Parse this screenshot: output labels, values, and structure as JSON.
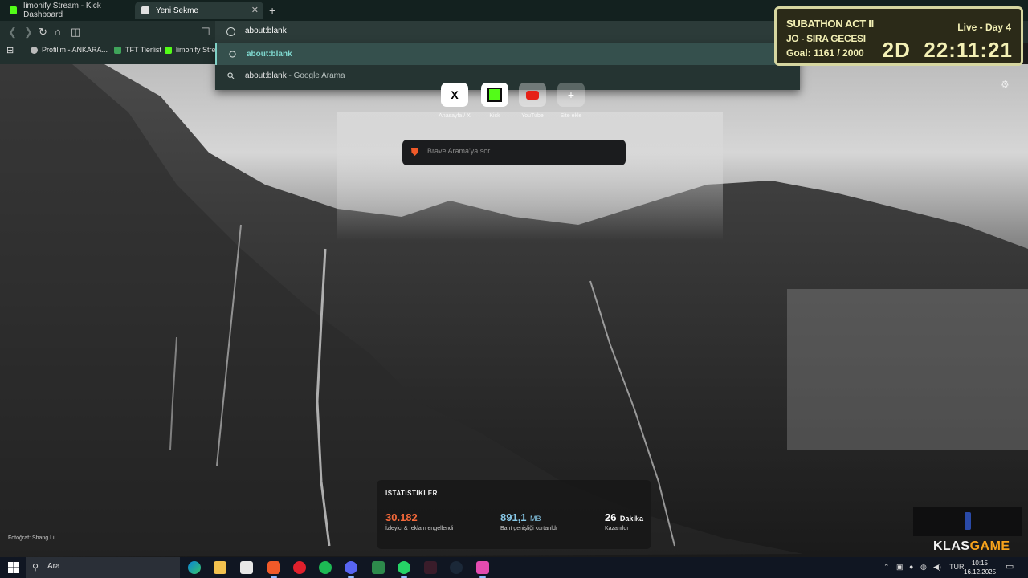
{
  "browser": {
    "tabs": [
      {
        "title": "limonify Stream - Kick Dashboard",
        "active": false
      },
      {
        "title": "Yeni Sekme",
        "active": true
      }
    ],
    "omnibox": {
      "value": "about:blank"
    },
    "bookmarks": [
      {
        "label": "Profilim - ANKARA..."
      },
      {
        "label": "TFT Tierlist"
      },
      {
        "label": "limonify Strea"
      }
    ],
    "suggestions": [
      {
        "text": "about:blank",
        "suffix": ""
      },
      {
        "text": "about:blank",
        "suffix": " - Google Arama"
      }
    ]
  },
  "newtab": {
    "shortcuts": [
      {
        "label": "Anasayfa / X",
        "icon": "x-icon"
      },
      {
        "label": "Kick",
        "icon": "kick-icon"
      },
      {
        "label": "YouTube",
        "icon": "youtube-icon"
      },
      {
        "label": "Site ekle",
        "icon": "plus-icon"
      }
    ],
    "search_placeholder": "Brave Arama'ya sor",
    "photo_credit": "Fotoğraf: Shang Li",
    "stats": {
      "title": "İSTATİSTİKLER",
      "items": [
        {
          "value": "30.182",
          "unit": "",
          "desc": "İzleyici & reklam engellendi",
          "color": "#f3683a"
        },
        {
          "value": "891,1",
          "unit": "MB",
          "desc": "Bant genişliği kurtarıldı",
          "color": "#88c9e8"
        },
        {
          "value": "26",
          "unit": "Dakika",
          "desc": "Kazanıldı",
          "color": "#ffffff"
        }
      ]
    }
  },
  "overlay": {
    "title": "SUBATHON ACT II",
    "status": "Live - Day 4",
    "line2": "JO - SIRA GECESI",
    "goal": "Goal: 1161 / 2000",
    "timer": "2D  22:11:21",
    "brand_main": "KLAS",
    "brand_accent": "GAME"
  },
  "taskbar": {
    "search_placeholder": "Ara",
    "language": "TUR",
    "time": "10:15",
    "date": "16.12.2025",
    "apps": [
      "edge-icon",
      "explorer-icon",
      "store-icon",
      "brave-icon",
      "opera-icon",
      "spotify-icon",
      "discord-icon",
      "app-icon",
      "whatsapp-icon",
      "capcut-icon",
      "steam-icon",
      "app2-icon"
    ]
  }
}
